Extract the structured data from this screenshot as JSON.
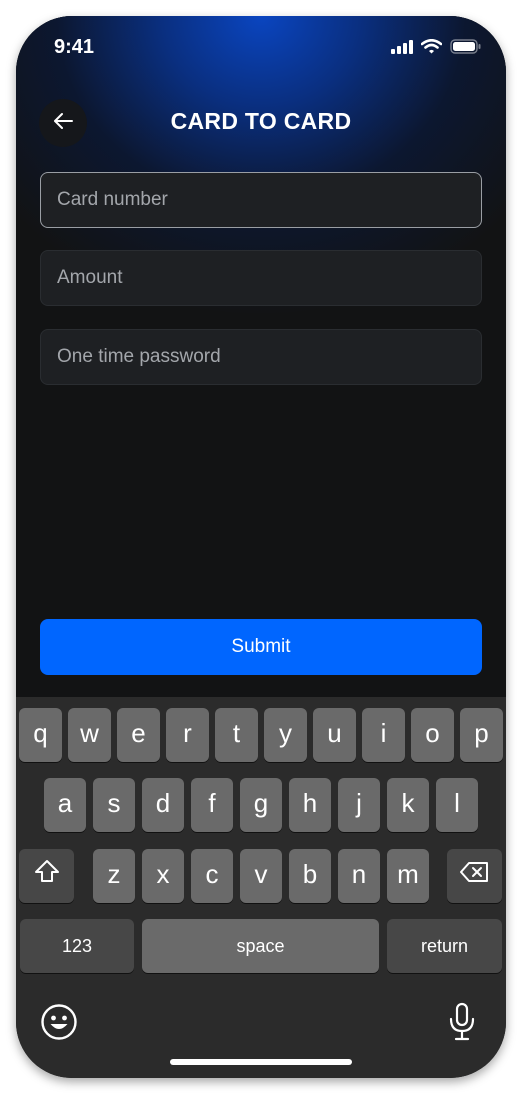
{
  "status_bar": {
    "time": "9:41",
    "icons": [
      "cellular-signal-icon",
      "wifi-icon",
      "battery-icon"
    ]
  },
  "header": {
    "title": "CARD TO CARD",
    "back_icon": "arrow-left-icon"
  },
  "form": {
    "card_number": {
      "placeholder": "Card number",
      "value": ""
    },
    "amount": {
      "placeholder": "Amount",
      "value": ""
    },
    "otp": {
      "placeholder": "One time password",
      "value": ""
    },
    "submit_label": "Submit"
  },
  "keyboard": {
    "row1": [
      "q",
      "w",
      "e",
      "r",
      "t",
      "y",
      "u",
      "i",
      "o",
      "p"
    ],
    "row2": [
      "a",
      "s",
      "d",
      "f",
      "g",
      "h",
      "j",
      "k",
      "l"
    ],
    "row3": [
      "z",
      "x",
      "c",
      "v",
      "b",
      "n",
      "m"
    ],
    "numbers_label": "123",
    "space_label": "space",
    "return_label": "return",
    "shift_icon": "shift-icon",
    "delete_icon": "delete-icon",
    "emoji_icon": "emoji-icon",
    "mic_icon": "microphone-icon"
  },
  "colors": {
    "accent": "#0066ff",
    "background": "#121314",
    "field_background": "#1e2023",
    "keyboard_background": "#2b2b2b",
    "key_background": "#6a6a6a",
    "key_dark_background": "#474747"
  }
}
